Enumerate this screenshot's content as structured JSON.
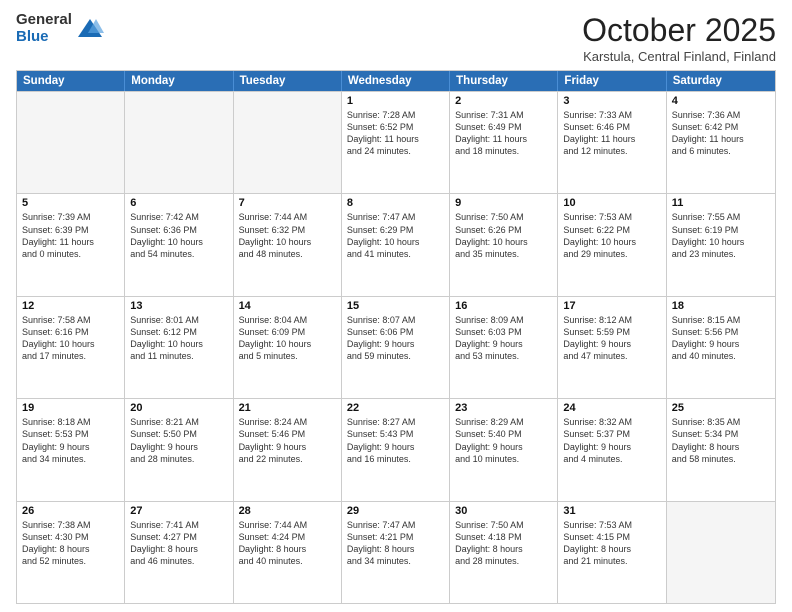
{
  "logo": {
    "general": "General",
    "blue": "Blue"
  },
  "title": "October 2025",
  "location": "Karstula, Central Finland, Finland",
  "weekdays": [
    "Sunday",
    "Monday",
    "Tuesday",
    "Wednesday",
    "Thursday",
    "Friday",
    "Saturday"
  ],
  "rows": [
    [
      {
        "day": "",
        "info": ""
      },
      {
        "day": "",
        "info": ""
      },
      {
        "day": "",
        "info": ""
      },
      {
        "day": "1",
        "info": "Sunrise: 7:28 AM\nSunset: 6:52 PM\nDaylight: 11 hours\nand 24 minutes."
      },
      {
        "day": "2",
        "info": "Sunrise: 7:31 AM\nSunset: 6:49 PM\nDaylight: 11 hours\nand 18 minutes."
      },
      {
        "day": "3",
        "info": "Sunrise: 7:33 AM\nSunset: 6:46 PM\nDaylight: 11 hours\nand 12 minutes."
      },
      {
        "day": "4",
        "info": "Sunrise: 7:36 AM\nSunset: 6:42 PM\nDaylight: 11 hours\nand 6 minutes."
      }
    ],
    [
      {
        "day": "5",
        "info": "Sunrise: 7:39 AM\nSunset: 6:39 PM\nDaylight: 11 hours\nand 0 minutes."
      },
      {
        "day": "6",
        "info": "Sunrise: 7:42 AM\nSunset: 6:36 PM\nDaylight: 10 hours\nand 54 minutes."
      },
      {
        "day": "7",
        "info": "Sunrise: 7:44 AM\nSunset: 6:32 PM\nDaylight: 10 hours\nand 48 minutes."
      },
      {
        "day": "8",
        "info": "Sunrise: 7:47 AM\nSunset: 6:29 PM\nDaylight: 10 hours\nand 41 minutes."
      },
      {
        "day": "9",
        "info": "Sunrise: 7:50 AM\nSunset: 6:26 PM\nDaylight: 10 hours\nand 35 minutes."
      },
      {
        "day": "10",
        "info": "Sunrise: 7:53 AM\nSunset: 6:22 PM\nDaylight: 10 hours\nand 29 minutes."
      },
      {
        "day": "11",
        "info": "Sunrise: 7:55 AM\nSunset: 6:19 PM\nDaylight: 10 hours\nand 23 minutes."
      }
    ],
    [
      {
        "day": "12",
        "info": "Sunrise: 7:58 AM\nSunset: 6:16 PM\nDaylight: 10 hours\nand 17 minutes."
      },
      {
        "day": "13",
        "info": "Sunrise: 8:01 AM\nSunset: 6:12 PM\nDaylight: 10 hours\nand 11 minutes."
      },
      {
        "day": "14",
        "info": "Sunrise: 8:04 AM\nSunset: 6:09 PM\nDaylight: 10 hours\nand 5 minutes."
      },
      {
        "day": "15",
        "info": "Sunrise: 8:07 AM\nSunset: 6:06 PM\nDaylight: 9 hours\nand 59 minutes."
      },
      {
        "day": "16",
        "info": "Sunrise: 8:09 AM\nSunset: 6:03 PM\nDaylight: 9 hours\nand 53 minutes."
      },
      {
        "day": "17",
        "info": "Sunrise: 8:12 AM\nSunset: 5:59 PM\nDaylight: 9 hours\nand 47 minutes."
      },
      {
        "day": "18",
        "info": "Sunrise: 8:15 AM\nSunset: 5:56 PM\nDaylight: 9 hours\nand 40 minutes."
      }
    ],
    [
      {
        "day": "19",
        "info": "Sunrise: 8:18 AM\nSunset: 5:53 PM\nDaylight: 9 hours\nand 34 minutes."
      },
      {
        "day": "20",
        "info": "Sunrise: 8:21 AM\nSunset: 5:50 PM\nDaylight: 9 hours\nand 28 minutes."
      },
      {
        "day": "21",
        "info": "Sunrise: 8:24 AM\nSunset: 5:46 PM\nDaylight: 9 hours\nand 22 minutes."
      },
      {
        "day": "22",
        "info": "Sunrise: 8:27 AM\nSunset: 5:43 PM\nDaylight: 9 hours\nand 16 minutes."
      },
      {
        "day": "23",
        "info": "Sunrise: 8:29 AM\nSunset: 5:40 PM\nDaylight: 9 hours\nand 10 minutes."
      },
      {
        "day": "24",
        "info": "Sunrise: 8:32 AM\nSunset: 5:37 PM\nDaylight: 9 hours\nand 4 minutes."
      },
      {
        "day": "25",
        "info": "Sunrise: 8:35 AM\nSunset: 5:34 PM\nDaylight: 8 hours\nand 58 minutes."
      }
    ],
    [
      {
        "day": "26",
        "info": "Sunrise: 7:38 AM\nSunset: 4:30 PM\nDaylight: 8 hours\nand 52 minutes."
      },
      {
        "day": "27",
        "info": "Sunrise: 7:41 AM\nSunset: 4:27 PM\nDaylight: 8 hours\nand 46 minutes."
      },
      {
        "day": "28",
        "info": "Sunrise: 7:44 AM\nSunset: 4:24 PM\nDaylight: 8 hours\nand 40 minutes."
      },
      {
        "day": "29",
        "info": "Sunrise: 7:47 AM\nSunset: 4:21 PM\nDaylight: 8 hours\nand 34 minutes."
      },
      {
        "day": "30",
        "info": "Sunrise: 7:50 AM\nSunset: 4:18 PM\nDaylight: 8 hours\nand 28 minutes."
      },
      {
        "day": "31",
        "info": "Sunrise: 7:53 AM\nSunset: 4:15 PM\nDaylight: 8 hours\nand 21 minutes."
      },
      {
        "day": "",
        "info": ""
      }
    ]
  ]
}
